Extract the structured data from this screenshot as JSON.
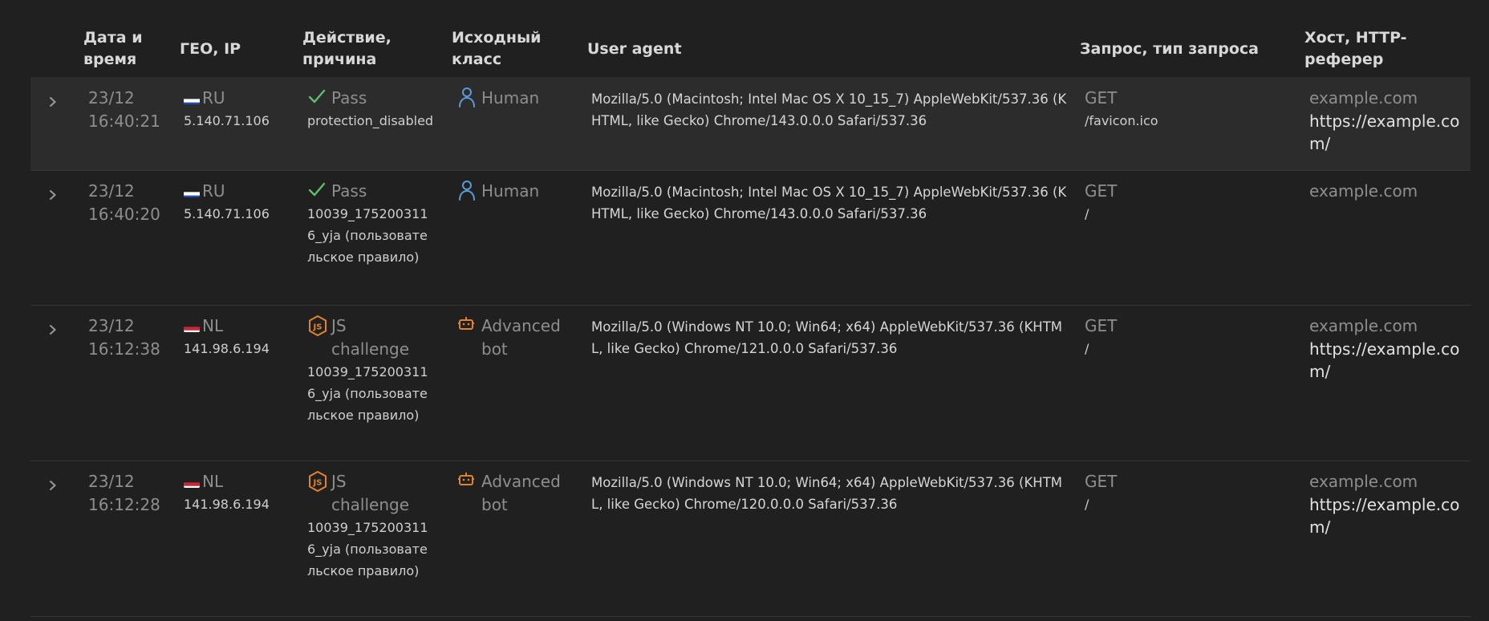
{
  "columns": [
    "Дата и время",
    "ГЕО, IP",
    "Действие, причина",
    "Исходный класс",
    "User agent",
    "Запрос, тип запроса",
    "Хост, HTTP-реферер"
  ],
  "colors": {
    "pass": "#5fbf6a",
    "challenge": "#e0832f",
    "human": "#5b9bd5",
    "bot": "#e0832f"
  },
  "rows": [
    {
      "date": "23/12",
      "time": "16:40:21",
      "country": "RU",
      "ip": "5.140.71.106",
      "action": "Pass",
      "action_icon": "check-icon",
      "reason": "protection_disabled",
      "class": "Human",
      "class_icon": "person-icon",
      "ua": "Mozilla/5.0 (Macintosh; Intel Mac OS X 10_15_7) AppleWebKit/537.36 (KHTML, like Gecko) Chrome/143.0.0.0 Safari/537.36",
      "method": "GET",
      "path": "/favicon.ico",
      "host": "example.com",
      "referer": "https://example.com/"
    },
    {
      "date": "23/12",
      "time": "16:40:20",
      "country": "RU",
      "ip": "5.140.71.106",
      "action": "Pass",
      "action_icon": "check-icon",
      "reason": "10039_1752003116_yja (пользовательское правило)",
      "class": "Human",
      "class_icon": "person-icon",
      "ua": "Mozilla/5.0 (Macintosh; Intel Mac OS X 10_15_7) AppleWebKit/537.36 (KHTML, like Gecko) Chrome/143.0.0.0 Safari/537.36",
      "method": "GET",
      "path": "/",
      "host": "example.com",
      "referer": ""
    },
    {
      "date": "23/12",
      "time": "16:12:38",
      "country": "NL",
      "ip": "141.98.6.194",
      "action": "JS challenge",
      "action_icon": "js-shield-icon",
      "reason": "10039_1752003116_yja (пользовательское правило)",
      "class": "Advanced bot",
      "class_icon": "robot-icon",
      "ua": "Mozilla/5.0 (Windows NT 10.0; Win64; x64) AppleWebKit/537.36 (KHTML, like Gecko) Chrome/121.0.0.0 Safari/537.36",
      "method": "GET",
      "path": "/",
      "host": "example.com",
      "referer": "https://example.com/"
    },
    {
      "date": "23/12",
      "time": "16:12:28",
      "country": "NL",
      "ip": "141.98.6.194",
      "action": "JS challenge",
      "action_icon": "js-shield-icon",
      "reason": "10039_1752003116_yja (пользовательское правило)",
      "class": "Advanced bot",
      "class_icon": "robot-icon",
      "ua": "Mozilla/5.0 (Windows NT 10.0; Win64; x64) AppleWebKit/537.36 (KHTML, like Gecko) Chrome/120.0.0.0 Safari/537.36",
      "method": "GET",
      "path": "/",
      "host": "example.com",
      "referer": "https://example.com/"
    }
  ]
}
